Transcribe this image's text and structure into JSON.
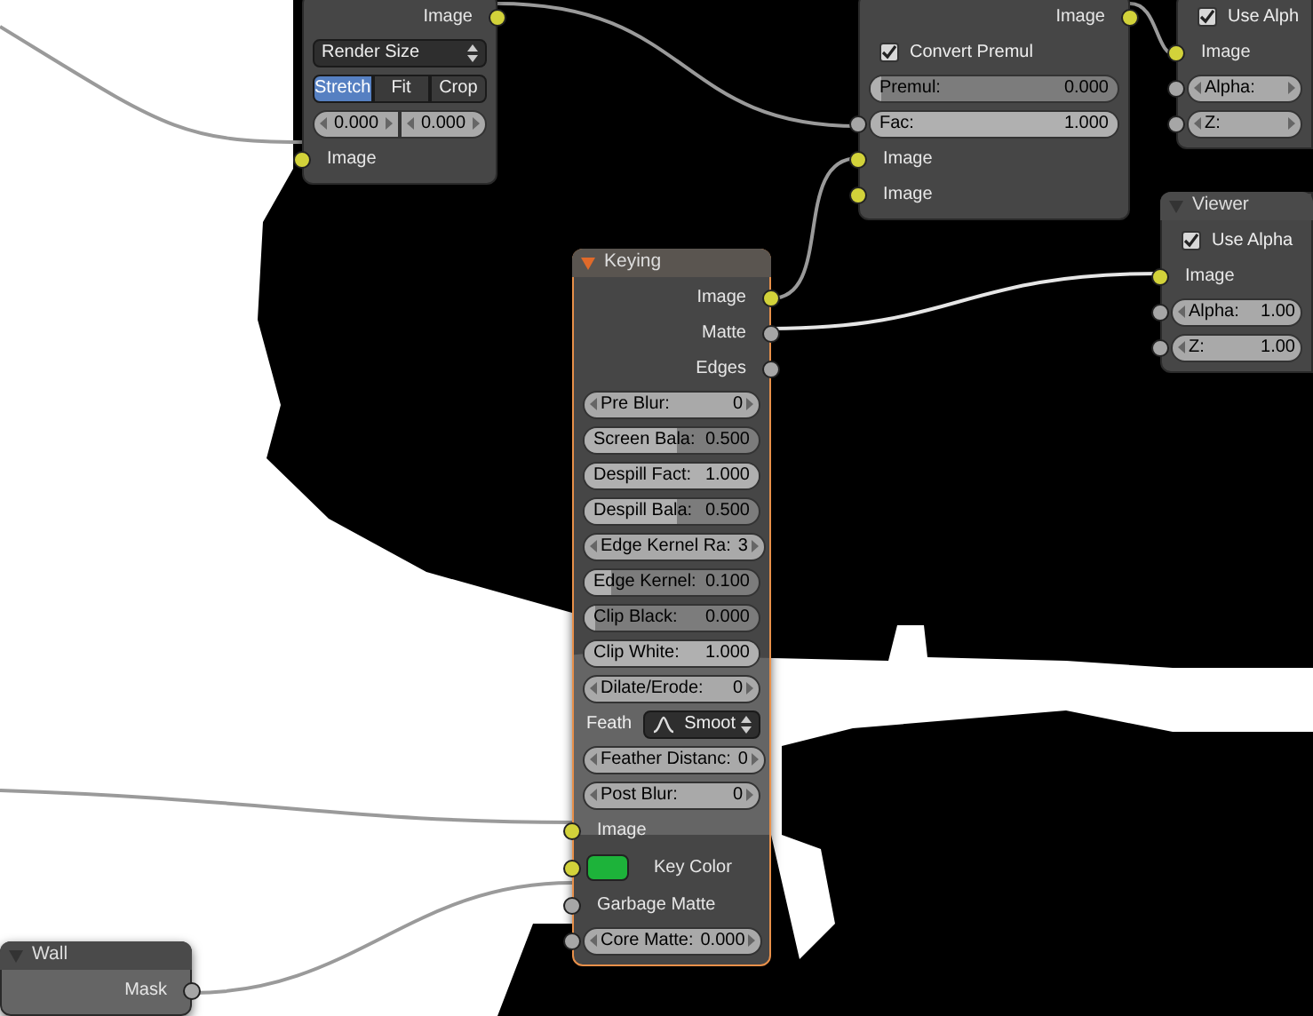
{
  "nodes": [
    {
      "selected": false,
      "rows": [
        {
          "kind": "output",
          "label": "Image",
          "socket": {
            "color": "#d2d23a"
          }
        },
        {
          "kind": "dropdown",
          "value": "Render Size"
        },
        {
          "kind": "segmented",
          "options": [
            {
              "label": "Stretch",
              "selected": true
            },
            {
              "label": "Fit",
              "selected": false
            },
            {
              "label": "Crop",
              "selected": false
            }
          ]
        },
        {
          "kind": "numbers",
          "values": [
            "0.000",
            "0.000"
          ]
        },
        {
          "kind": "input",
          "label": "Image",
          "socket": {
            "color": "#d2d23a"
          }
        }
      ]
    },
    {
      "selected": false,
      "rows": [
        {
          "kind": "output",
          "label": "Image",
          "socket": {
            "color": "#d2d23a"
          }
        },
        {
          "kind": "checkbox",
          "label": "Convert Premul",
          "checked": true
        },
        {
          "kind": "slider",
          "label": "Premul:",
          "value": "0.000",
          "level": 0
        },
        {
          "kind": "slider",
          "label": "Fac:",
          "value": "1.000",
          "level": 1,
          "socket": {
            "color": "#a6a6a6"
          }
        },
        {
          "kind": "input",
          "label": "Image",
          "socket": {
            "color": "#d2d23a"
          }
        },
        {
          "kind": "input",
          "label": "Image",
          "socket": {
            "color": "#d2d23a"
          }
        }
      ]
    },
    {
      "selected": false,
      "rows": [
        {
          "kind": "checkbox",
          "label": "Use Alph",
          "checked": true
        },
        {
          "kind": "input",
          "label": "Image",
          "socket": {
            "color": "#d2d23a"
          }
        },
        {
          "kind": "number",
          "label": "Alpha:",
          "socket": {
            "color": "#a6a6a6"
          }
        },
        {
          "kind": "number",
          "label": "Z:",
          "socket": {
            "color": "#a6a6a6"
          }
        }
      ]
    },
    {
      "title": "Viewer",
      "selected": false,
      "rows": [
        {
          "kind": "checkbox",
          "label": "Use Alpha",
          "checked": true
        },
        {
          "kind": "input",
          "label": "Image",
          "socket": {
            "color": "#d2d23a"
          }
        },
        {
          "kind": "number",
          "label": "Alpha:",
          "value": "1.00",
          "socket": {
            "color": "#a6a6a6"
          }
        },
        {
          "kind": "number",
          "label": "Z:",
          "value": "1.00",
          "socket": {
            "color": "#a6a6a6"
          }
        }
      ]
    },
    {
      "title": "Keying",
      "selected": true,
      "rows": [
        {
          "kind": "output",
          "label": "Image",
          "socket": {
            "color": "#d2d23a"
          }
        },
        {
          "kind": "output",
          "label": "Matte",
          "socket": {
            "color": "#a6a6a6"
          }
        },
        {
          "kind": "output",
          "label": "Edges",
          "socket": {
            "color": "#a6a6a6"
          }
        },
        {
          "kind": "number",
          "label": "Pre Blur:",
          "value": "0"
        },
        {
          "kind": "slider",
          "label": "Screen Bala:",
          "value": "0.500",
          "level": 0.5
        },
        {
          "kind": "slider",
          "label": "Despill Fact:",
          "value": "1.000",
          "level": 1
        },
        {
          "kind": "slider",
          "label": "Despill Bala:",
          "value": "0.500",
          "level": 0.5
        },
        {
          "kind": "number",
          "label": "Edge Kernel Ra:",
          "value": "3"
        },
        {
          "kind": "slider",
          "label": "Edge Kernel:",
          "value": "0.100",
          "level": 0.1
        },
        {
          "kind": "slider",
          "label": "Clip Black:",
          "value": "0.000",
          "level": 0
        },
        {
          "kind": "slider",
          "label": "Clip White:",
          "value": "1.000",
          "level": 1
        },
        {
          "kind": "number",
          "label": "Dilate/Erode:",
          "value": "0"
        },
        {
          "kind": "dropdown",
          "label": "Feath",
          "value": "Smoot"
        },
        {
          "kind": "number",
          "label": "Feather Distanc:",
          "value": "0"
        },
        {
          "kind": "number",
          "label": "Post Blur:",
          "value": "0"
        },
        {
          "kind": "input",
          "label": "Image",
          "socket": {
            "color": "#d2d23a"
          }
        },
        {
          "kind": "color",
          "label": "Key Color",
          "color": "#1db33a",
          "socket": {
            "color": "#d2d23a"
          }
        },
        {
          "kind": "input",
          "label": "Garbage Matte",
          "socket": {
            "color": "#a6a6a6"
          }
        },
        {
          "kind": "number",
          "label": "Core Matte:",
          "value": "0.000",
          "socket": {
            "color": "#a6a6a6"
          }
        }
      ]
    },
    {
      "title": "Wall",
      "selected": false,
      "rows": [
        {
          "kind": "output",
          "label": "Mask",
          "socket": {
            "color": "#a6a6a6"
          }
        }
      ]
    }
  ]
}
